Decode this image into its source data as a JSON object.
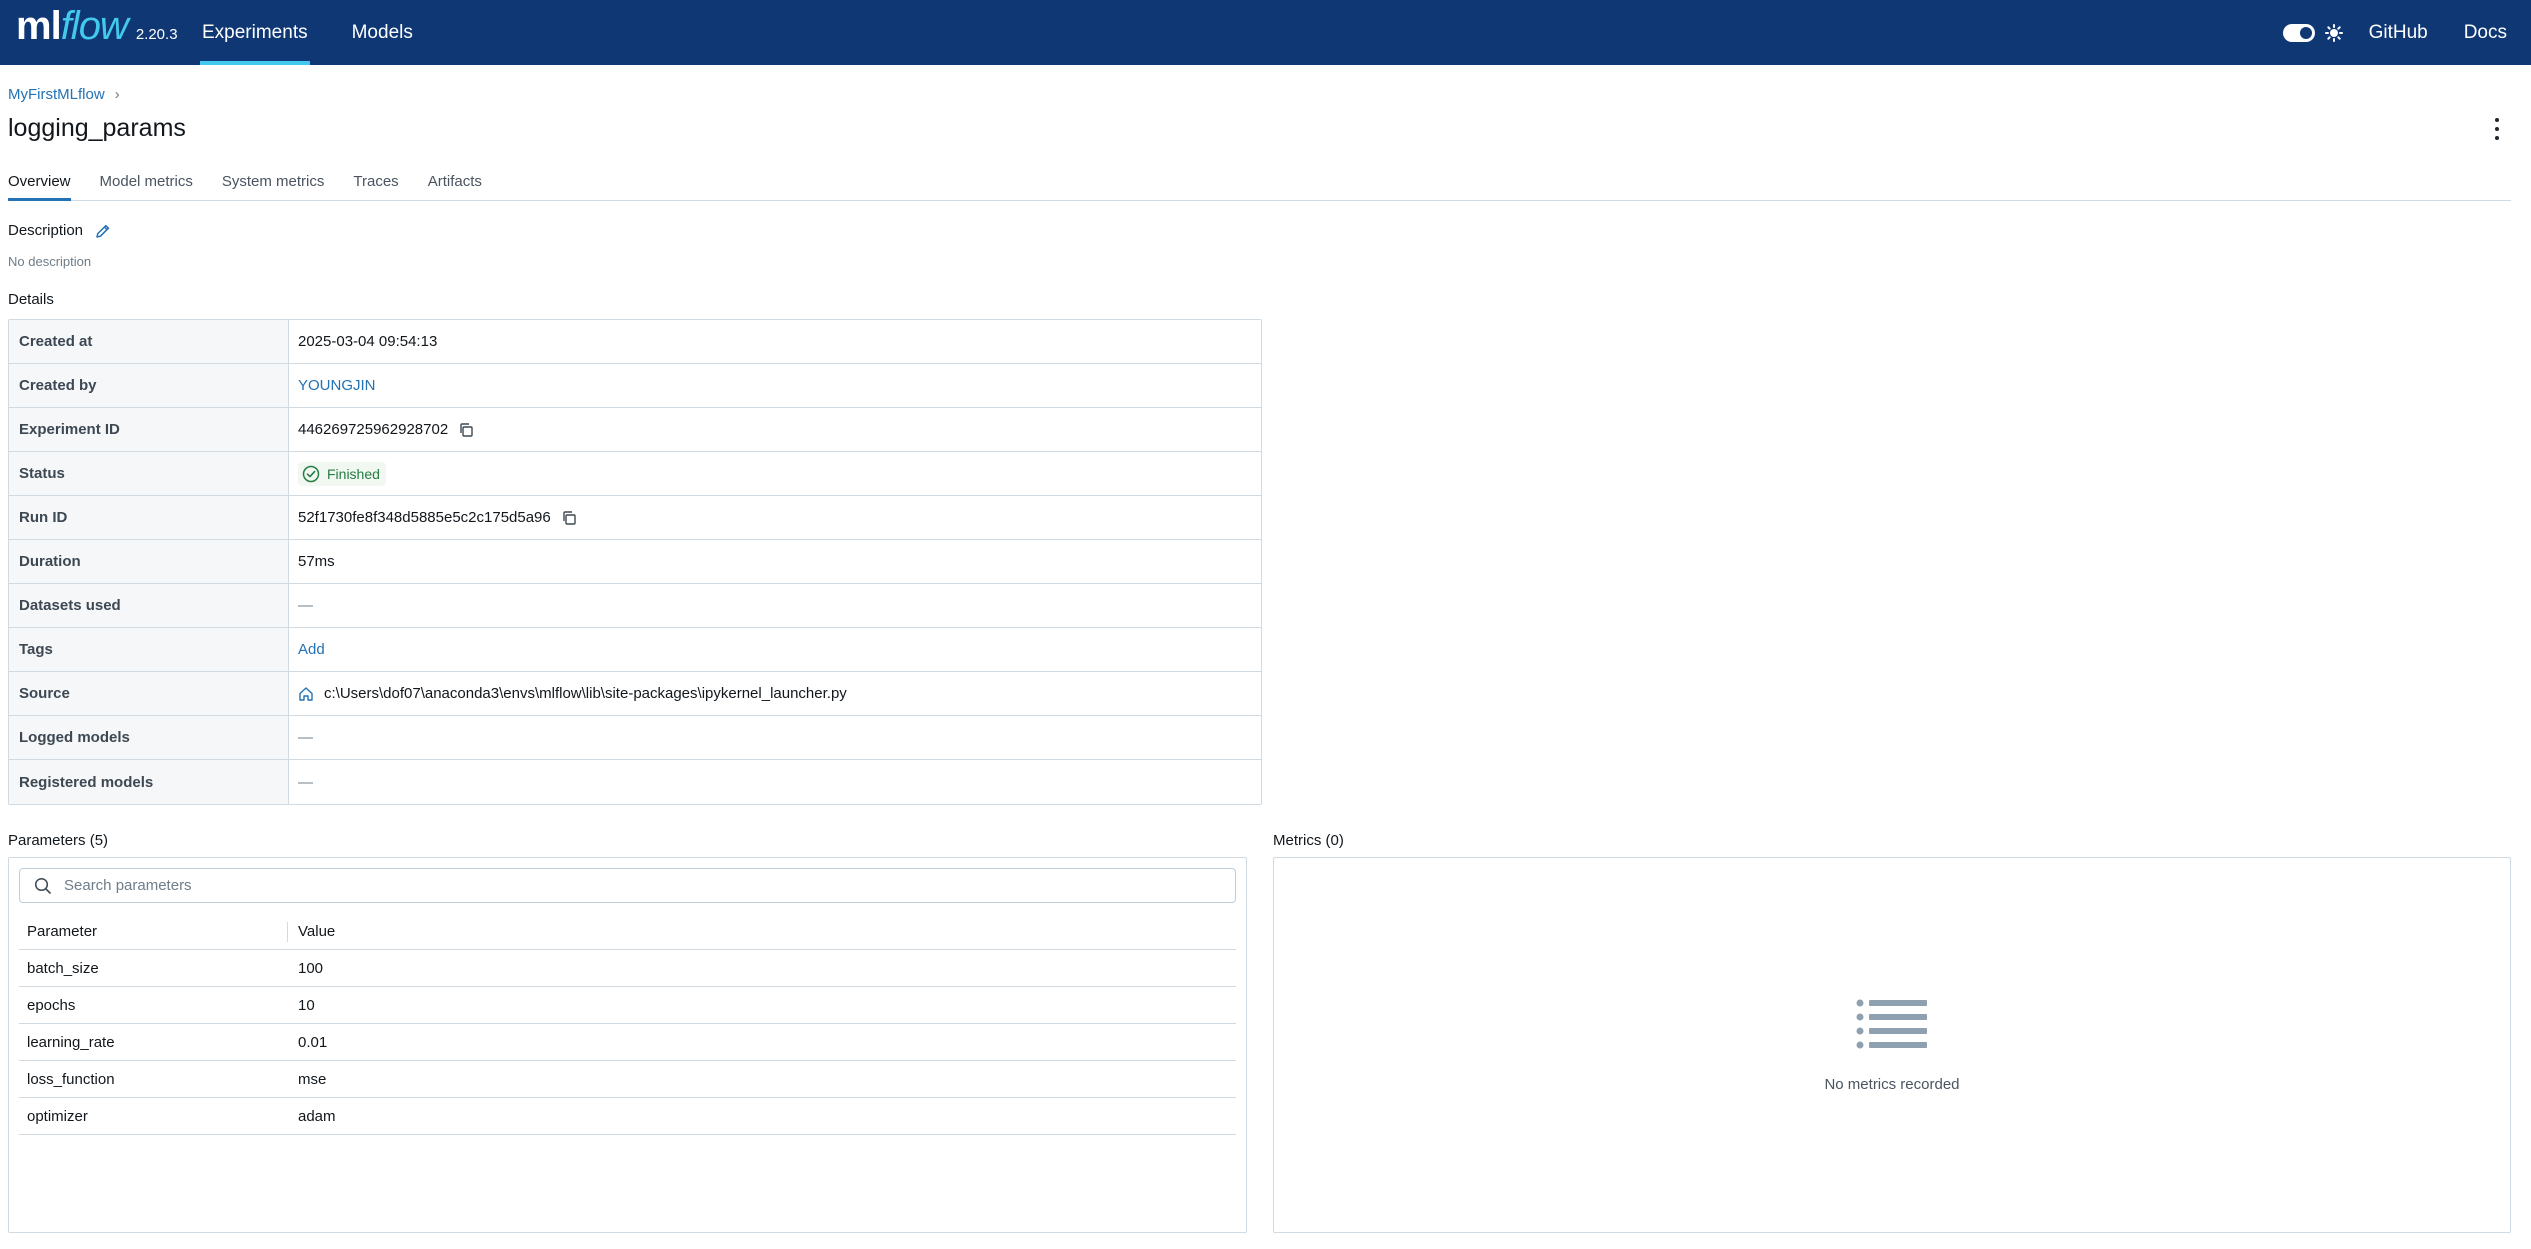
{
  "header": {
    "logo_ml": "ml",
    "logo_flow": "flow",
    "version": "2.20.3",
    "nav": [
      "Experiments",
      "Models"
    ],
    "active_nav": "Experiments",
    "links": [
      "GitHub",
      "Docs"
    ],
    "colors": {
      "background": "#0e3774",
      "accent": "#43c9ed"
    }
  },
  "breadcrumb": {
    "experiment": "MyFirstMLflow",
    "separator": "›"
  },
  "run": {
    "title": "logging_params"
  },
  "tabs": [
    "Overview",
    "Model metrics",
    "System metrics",
    "Traces",
    "Artifacts"
  ],
  "active_tab": "Overview",
  "description": {
    "label": "Description",
    "empty_text": "No description",
    "edit_icon": "pencil-icon"
  },
  "details": {
    "label": "Details",
    "created_at": {
      "label": "Created at",
      "value": "2025-03-04 09:54:13"
    },
    "created_by": {
      "label": "Created by",
      "value": "YOUNGJIN"
    },
    "experiment_id": {
      "label": "Experiment ID",
      "value": "446269725962928702"
    },
    "status": {
      "label": "Status",
      "value": "Finished",
      "color": "#277c43"
    },
    "run_id": {
      "label": "Run ID",
      "value": "52f1730fe8f348d5885e5c2c175d5a96"
    },
    "duration": {
      "label": "Duration",
      "value": "57ms"
    },
    "datasets_used": {
      "label": "Datasets used",
      "value": "—"
    },
    "tags": {
      "label": "Tags",
      "value": "Add"
    },
    "source": {
      "label": "Source",
      "value": "c:\\Users\\dof07\\anaconda3\\envs\\mlflow\\lib\\site-packages\\ipykernel_launcher.py"
    },
    "logged_models": {
      "label": "Logged models",
      "value": "—"
    },
    "registered_models": {
      "label": "Registered models",
      "value": "—"
    }
  },
  "parameters": {
    "label": "Parameters (5)",
    "search_placeholder": "Search parameters",
    "columns": [
      "Parameter",
      "Value"
    ],
    "rows": [
      {
        "name": "batch_size",
        "value": "100"
      },
      {
        "name": "epochs",
        "value": "10"
      },
      {
        "name": "learning_rate",
        "value": "0.01"
      },
      {
        "name": "loss_function",
        "value": "mse"
      },
      {
        "name": "optimizer",
        "value": "adam"
      }
    ]
  },
  "metrics": {
    "label": "Metrics (0)",
    "empty_text": "No metrics recorded",
    "empty_icon": "list-icon"
  }
}
